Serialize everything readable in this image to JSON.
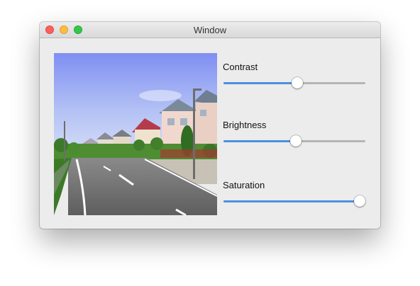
{
  "window": {
    "title": "Window"
  },
  "image": {
    "subject": "suburban-street-photo"
  },
  "sliders": [
    {
      "label": "Contrast",
      "value": 0.52
    },
    {
      "label": "Brightness",
      "value": 0.51
    },
    {
      "label": "Saturation",
      "value": 0.96
    }
  ],
  "colors": {
    "accent": "#4a90e2",
    "track": "#b5b5b5",
    "close": "#fc605c",
    "minimize": "#fdbc40",
    "maximize": "#34c84a"
  }
}
